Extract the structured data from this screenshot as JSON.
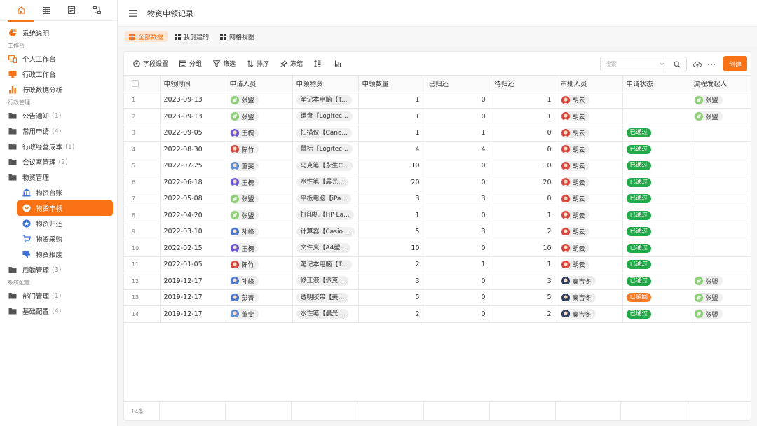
{
  "sidebar": {
    "tabs": [
      {
        "icon": "home-icon"
      },
      {
        "icon": "table-icon"
      },
      {
        "icon": "document-icon"
      },
      {
        "icon": "flow-icon"
      }
    ],
    "items": [
      {
        "kind": "item",
        "label": "系统说明",
        "icon": "pie-chart-icon",
        "color": "#f97316"
      },
      {
        "kind": "section",
        "label": "工作台"
      },
      {
        "kind": "item",
        "label": "个人工作台",
        "icon": "devices-icon",
        "color": "#f97316"
      },
      {
        "kind": "item",
        "label": "行政工作台",
        "icon": "monitor-icon",
        "color": "#f97316"
      },
      {
        "kind": "item",
        "label": "行政数据分析",
        "icon": "bar-chart-icon",
        "color": "#f97316"
      },
      {
        "kind": "section",
        "label": "行政管理"
      },
      {
        "kind": "folder",
        "label": "公告通知",
        "count": "(1)"
      },
      {
        "kind": "folder",
        "label": "常用申请",
        "count": "(4)"
      },
      {
        "kind": "folder",
        "label": "行政经营成本",
        "count": "(1)"
      },
      {
        "kind": "folder",
        "label": "会议室管理",
        "count": "(2)"
      },
      {
        "kind": "folder",
        "label": "物资管理",
        "count": ""
      },
      {
        "kind": "sub",
        "label": "物资台账",
        "icon": "bank-icon",
        "color": "#3b6fd8"
      },
      {
        "kind": "sub",
        "label": "物资申领",
        "icon": "chevron-circle-icon",
        "color": "#f97316",
        "active": true
      },
      {
        "kind": "sub",
        "label": "物资归还",
        "icon": "star-badge-icon",
        "color": "#3b6fd8"
      },
      {
        "kind": "sub",
        "label": "物资采购",
        "icon": "cart-icon",
        "color": "#3b6fd8"
      },
      {
        "kind": "sub",
        "label": "物资报废",
        "icon": "thumbs-down-icon",
        "color": "#3b6fd8"
      },
      {
        "kind": "folder",
        "label": "后勤管理",
        "count": "(3)"
      },
      {
        "kind": "section",
        "label": "系统配置"
      },
      {
        "kind": "folder",
        "label": "部门管理",
        "count": "(1)"
      },
      {
        "kind": "folder",
        "label": "基础配置",
        "count": "(4)"
      }
    ]
  },
  "header": {
    "title": "物资申领记录"
  },
  "views": [
    {
      "label": "全部数据",
      "active": true
    },
    {
      "label": "我创建的",
      "active": false
    },
    {
      "label": "网格视图",
      "active": false
    }
  ],
  "toolbar": {
    "tools": [
      {
        "label": "字段设置",
        "icon": "settings-icon"
      },
      {
        "label": "分组",
        "icon": "group-icon"
      },
      {
        "label": "筛选",
        "icon": "filter-icon"
      },
      {
        "label": "排序",
        "icon": "sort-icon"
      },
      {
        "label": "冻结",
        "icon": "pin-icon"
      },
      {
        "label": "",
        "icon": "row-height-icon"
      },
      {
        "label": "",
        "icon": "chart-icon"
      }
    ],
    "search_placeholder": "搜索",
    "create_label": "创建"
  },
  "columns": [
    "申领时间",
    "申请人员",
    "申领物资",
    "申领数量",
    "已归还",
    "待归还",
    "审批人员",
    "申请状态",
    "流程发起人"
  ],
  "avatars": {
    "张盟": {
      "color": "#8fcf7a",
      "type": "leaf"
    },
    "王槐": {
      "color": "#6b5bd6",
      "type": "person"
    },
    "陈竹": {
      "color": "#d9453b",
      "type": "person"
    },
    "董斐": {
      "color": "#5b8cd6",
      "type": "person"
    },
    "孙峰": {
      "color": "#4a78d0",
      "type": "person"
    },
    "彭菁": {
      "color": "#4a78d0",
      "type": "person"
    },
    "胡云": {
      "color": "#d9453b",
      "type": "person"
    },
    "秦吉冬": {
      "color": "#2f3e5c",
      "type": "person"
    }
  },
  "status_colors": {
    "已通过": "#22a846",
    "已驳回": "#f47a2a"
  },
  "rows": [
    {
      "idx": "1",
      "date": "2023-09-13",
      "applicant": "张盟",
      "item": "笔记本电脑【T...",
      "qty": "1",
      "returned": "0",
      "pending": "1",
      "approver": "胡云",
      "status": "",
      "initiator": "张盟"
    },
    {
      "idx": "2",
      "date": "2023-09-13",
      "applicant": "张盟",
      "item": "键盘【Logitec...",
      "qty": "1",
      "returned": "0",
      "pending": "1",
      "approver": "胡云",
      "status": "",
      "initiator": "张盟"
    },
    {
      "idx": "3",
      "date": "2022-09-05",
      "applicant": "王槐",
      "item": "扫描仪【Cano...",
      "qty": "1",
      "returned": "1",
      "pending": "0",
      "approver": "胡云",
      "status": "已通过",
      "initiator": ""
    },
    {
      "idx": "4",
      "date": "2022-08-30",
      "applicant": "陈竹",
      "item": "鼠标【Logitec...",
      "qty": "4",
      "returned": "4",
      "pending": "0",
      "approver": "胡云",
      "status": "已通过",
      "initiator": ""
    },
    {
      "idx": "5",
      "date": "2022-07-25",
      "applicant": "董斐",
      "item": "马克笔【永生C...",
      "qty": "10",
      "returned": "0",
      "pending": "10",
      "approver": "胡云",
      "status": "已通过",
      "initiator": ""
    },
    {
      "idx": "6",
      "date": "2022-06-18",
      "applicant": "王槐",
      "item": "水性笔【晨光...",
      "qty": "20",
      "returned": "0",
      "pending": "20",
      "approver": "胡云",
      "status": "已通过",
      "initiator": ""
    },
    {
      "idx": "7",
      "date": "2022-05-08",
      "applicant": "张盟",
      "item": "平板电脑【iPa...",
      "qty": "3",
      "returned": "3",
      "pending": "0",
      "approver": "胡云",
      "status": "已通过",
      "initiator": ""
    },
    {
      "idx": "8",
      "date": "2022-04-20",
      "applicant": "张盟",
      "item": "打印机【HP La...",
      "qty": "1",
      "returned": "0",
      "pending": "1",
      "approver": "胡云",
      "status": "已通过",
      "initiator": ""
    },
    {
      "idx": "9",
      "date": "2022-03-10",
      "applicant": "孙峰",
      "item": "计算器【Casio ...",
      "qty": "5",
      "returned": "3",
      "pending": "2",
      "approver": "胡云",
      "status": "已通过",
      "initiator": ""
    },
    {
      "idx": "10",
      "date": "2022-02-15",
      "applicant": "王槐",
      "item": "文件夹【A4塑...",
      "qty": "10",
      "returned": "0",
      "pending": "10",
      "approver": "胡云",
      "status": "已通过",
      "initiator": ""
    },
    {
      "idx": "11",
      "date": "2022-01-05",
      "applicant": "陈竹",
      "item": "笔记本电脑【T...",
      "qty": "2",
      "returned": "1",
      "pending": "1",
      "approver": "胡云",
      "status": "已通过",
      "initiator": ""
    },
    {
      "idx": "12",
      "date": "2019-12-17",
      "applicant": "孙峰",
      "item": "修正液【派克...",
      "qty": "3",
      "returned": "0",
      "pending": "3",
      "approver": "秦吉冬",
      "status": "已通过",
      "initiator": "张盟"
    },
    {
      "idx": "13",
      "date": "2019-12-17",
      "applicant": "彭菁",
      "item": "透明胶带【美...",
      "qty": "5",
      "returned": "0",
      "pending": "5",
      "approver": "秦吉冬",
      "status": "已驳回",
      "initiator": "张盟"
    },
    {
      "idx": "14",
      "date": "2019-12-17",
      "applicant": "董斐",
      "item": "水性笔【晨光...",
      "qty": "2",
      "returned": "0",
      "pending": "2",
      "approver": "秦吉冬",
      "status": "已通过",
      "initiator": "张盟"
    }
  ],
  "footer": {
    "count_label": "14条"
  }
}
